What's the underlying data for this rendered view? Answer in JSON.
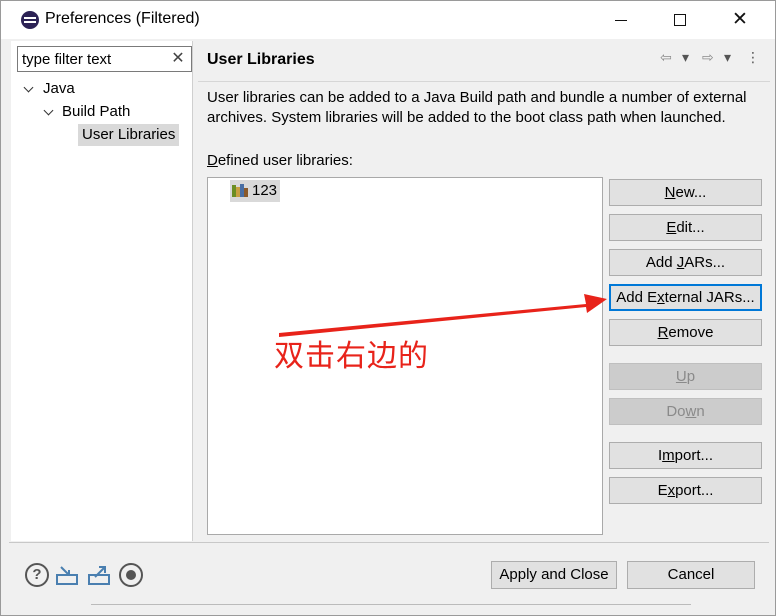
{
  "window": {
    "title": "Preferences (Filtered)",
    "min_symbol": "",
    "close_symbol": "✕"
  },
  "filter": {
    "placeholder": "type filter text",
    "clear_symbol": "✕"
  },
  "tree": {
    "items": [
      {
        "label": "Java",
        "expanded": true
      },
      {
        "label": "Build Path",
        "expanded": true
      },
      {
        "label": "User Libraries",
        "selected": true
      }
    ]
  },
  "page": {
    "title": "User Libraries",
    "description": "User libraries can be added to a Java Build path and bundle a number of external archives. System libraries will be added to the boot class path when launched.",
    "list_label_mnemonic": "D",
    "list_label_rest": "efined user libraries:",
    "libraries": [
      {
        "name": "123"
      }
    ]
  },
  "nav": {
    "back": "⇦",
    "back_menu": "▾",
    "forward": "⇨",
    "forward_menu": "▾",
    "more": "⋮"
  },
  "buttons": {
    "new": {
      "mnemonic": "N",
      "rest": "ew..."
    },
    "edit": {
      "mnemonic": "E",
      "rest": "dit..."
    },
    "add_jars": {
      "pre": "Add ",
      "mnemonic": "J",
      "rest": "ARs..."
    },
    "add_external_jars": {
      "pre": "Add E",
      "mnemonic": "x",
      "rest": "ternal JARs..."
    },
    "remove": {
      "mnemonic": "R",
      "rest": "emove"
    },
    "up": {
      "mnemonic": "U",
      "rest": "p"
    },
    "down": {
      "pre": "Do",
      "mnemonic": "w",
      "rest": "n"
    },
    "import": {
      "pre": "I",
      "mnemonic": "m",
      "rest": "port..."
    },
    "export": {
      "pre": "E",
      "mnemonic": "x",
      "rest": "port..."
    }
  },
  "annotation": {
    "text": "双击右边的",
    "color": "#e8231a"
  },
  "footer": {
    "apply_close": "Apply and Close",
    "cancel": "Cancel",
    "help_symbol": "?"
  },
  "colors": {
    "accent": "#0078d7",
    "selection": "#d9d9d9"
  }
}
